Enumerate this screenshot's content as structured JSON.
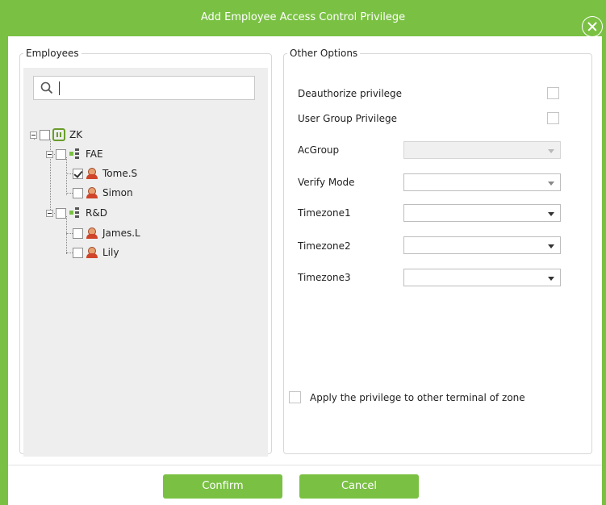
{
  "dialog": {
    "title": "Add Employee Access Control Privilege"
  },
  "employees": {
    "legend": "Employees",
    "search": {
      "value": "",
      "placeholder": ""
    },
    "tree": [
      {
        "label": "ZK",
        "type": "company",
        "checked": false,
        "expanded": true
      },
      {
        "label": "FAE",
        "type": "department",
        "checked": false,
        "expanded": true
      },
      {
        "label": "Tome.S",
        "type": "employee",
        "checked": true
      },
      {
        "label": "Simon",
        "type": "employee",
        "checked": false
      },
      {
        "label": "R&D",
        "type": "department",
        "checked": false,
        "expanded": true
      },
      {
        "label": "James.L",
        "type": "employee",
        "checked": false
      },
      {
        "label": "Lily",
        "type": "employee",
        "checked": false
      }
    ]
  },
  "options": {
    "legend": "Other Options",
    "deauthorize_label": "Deauthorize privilege",
    "user_group_label": "User Group Privilege",
    "acgroup_label": "AcGroup",
    "verify_mode_label": "Verify Mode",
    "timezone1_label": "Timezone1",
    "timezone2_label": "Timezone2",
    "timezone3_label": "Timezone3",
    "acgroup_value": "",
    "verify_mode_value": "",
    "timezone1_value": "",
    "timezone2_value": "",
    "timezone3_value": "",
    "apply_zone_label": "Apply the privilege to other terminal of zone"
  },
  "footer": {
    "confirm_label": "Confirm",
    "cancel_label": "Cancel"
  },
  "colors": {
    "accent": "#7ac143",
    "border": "#d8d8d8",
    "tree_background": "#eeeeee"
  }
}
